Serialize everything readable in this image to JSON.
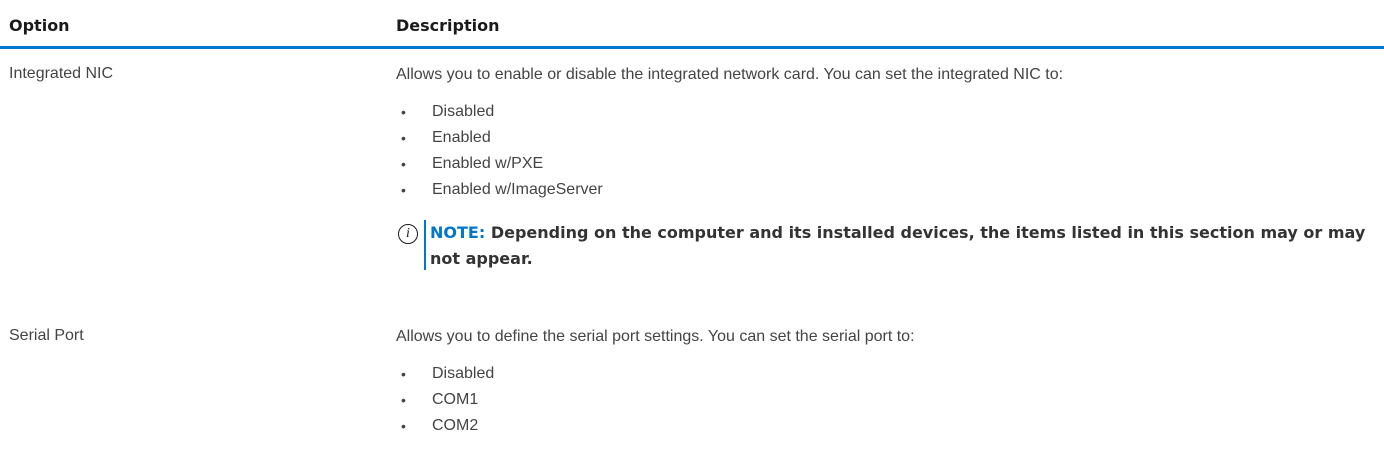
{
  "table": {
    "headers": {
      "option": "Option",
      "description": "Description"
    },
    "rows": [
      {
        "option": "Integrated NIC",
        "description": "Allows you to enable or disable the integrated network card. You can set the integrated NIC to:",
        "items": [
          "Disabled",
          "Enabled",
          "Enabled w/PXE",
          "Enabled w/ImageServer"
        ],
        "note": {
          "label": "NOTE:",
          "text": "Depending on the computer and its installed devices, the items listed in this section may or may not appear.",
          "icon": "info-circle-icon"
        }
      },
      {
        "option": "Serial Port",
        "description": "Allows you to define the serial port settings. You can set the serial port to:",
        "items": [
          "Disabled",
          "COM1",
          "COM2"
        ]
      }
    ]
  },
  "colors": {
    "accent": "#0076ce",
    "text": "#444444"
  }
}
